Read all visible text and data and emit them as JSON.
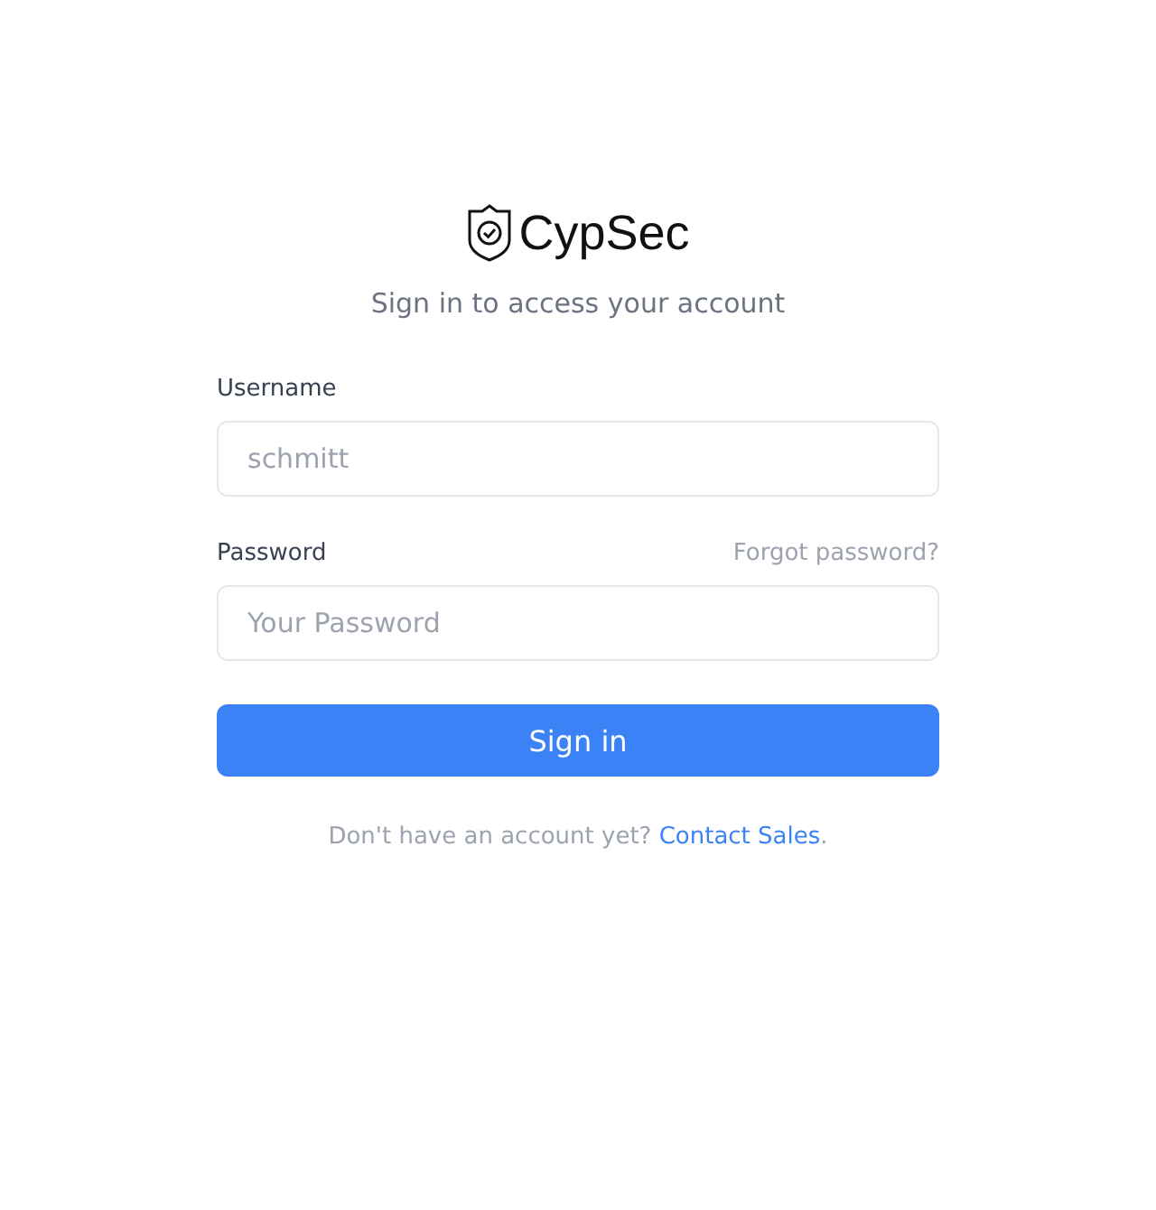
{
  "logo": {
    "text": "CypSec"
  },
  "subtitle": "Sign in to access your account",
  "fields": [
    {
      "label": "Username",
      "placeholder": "schmitt"
    },
    {
      "label": "Password",
      "placeholder": "Your Password",
      "link": "Forgot password?"
    }
  ],
  "submit": "Sign in",
  "footer": {
    "text": "Don't have an account yet?",
    "link": "Contact Sales",
    "end": "."
  }
}
